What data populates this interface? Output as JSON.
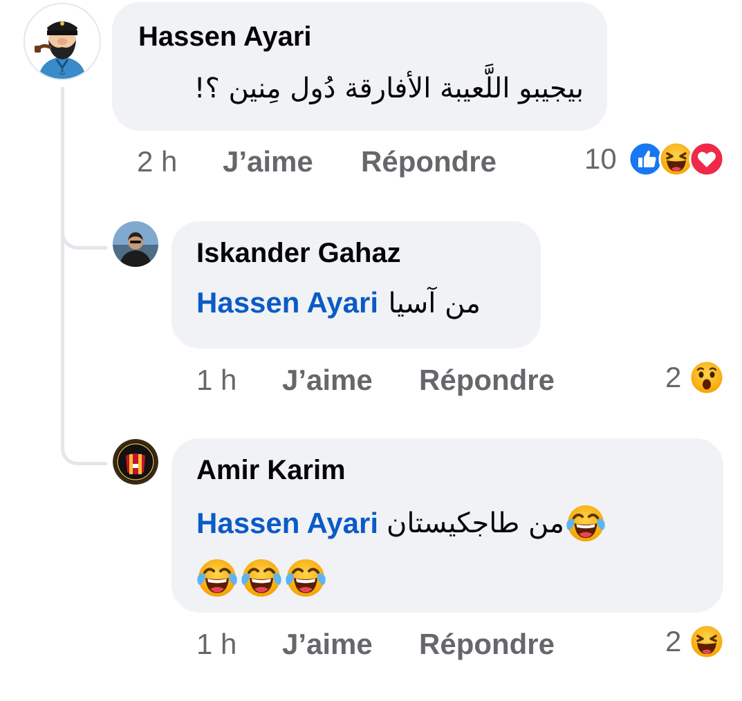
{
  "comments": [
    {
      "author": "Hassen Ayari",
      "text": "بيجيبو اللَّعيبة الأفارقة دُول مِنين ؟!",
      "time": "2 h",
      "like_label": "J’aime",
      "reply_label": "Répondre",
      "reaction_count": "10",
      "reactions": [
        "like-icon",
        "haha-icon",
        "love-icon"
      ]
    },
    {
      "author": "Iskander Gahaz",
      "mention": "Hassen Ayari",
      "text": "من آسيا",
      "time": "1 h",
      "like_label": "J’aime",
      "reply_label": "Répondre",
      "reaction_count": "2",
      "reactions": [
        "wow-icon"
      ]
    },
    {
      "author": "Amir Karim",
      "mention": "Hassen Ayari",
      "text": "من طاجكيستان",
      "emoji_line": [
        "tears-of-joy-emoji",
        "tears-of-joy-emoji",
        "tears-of-joy-emoji"
      ],
      "time": "1 h",
      "like_label": "J’aime",
      "reply_label": "Répondre",
      "reaction_count": "2",
      "reactions": [
        "haha-icon"
      ]
    }
  ],
  "colors": {
    "bubble": "#f0f2f5",
    "mention": "#0a5bc6",
    "meta": "#65676b",
    "like": "#1877f2",
    "love": "#f02849",
    "emoji": "#f7b125"
  }
}
